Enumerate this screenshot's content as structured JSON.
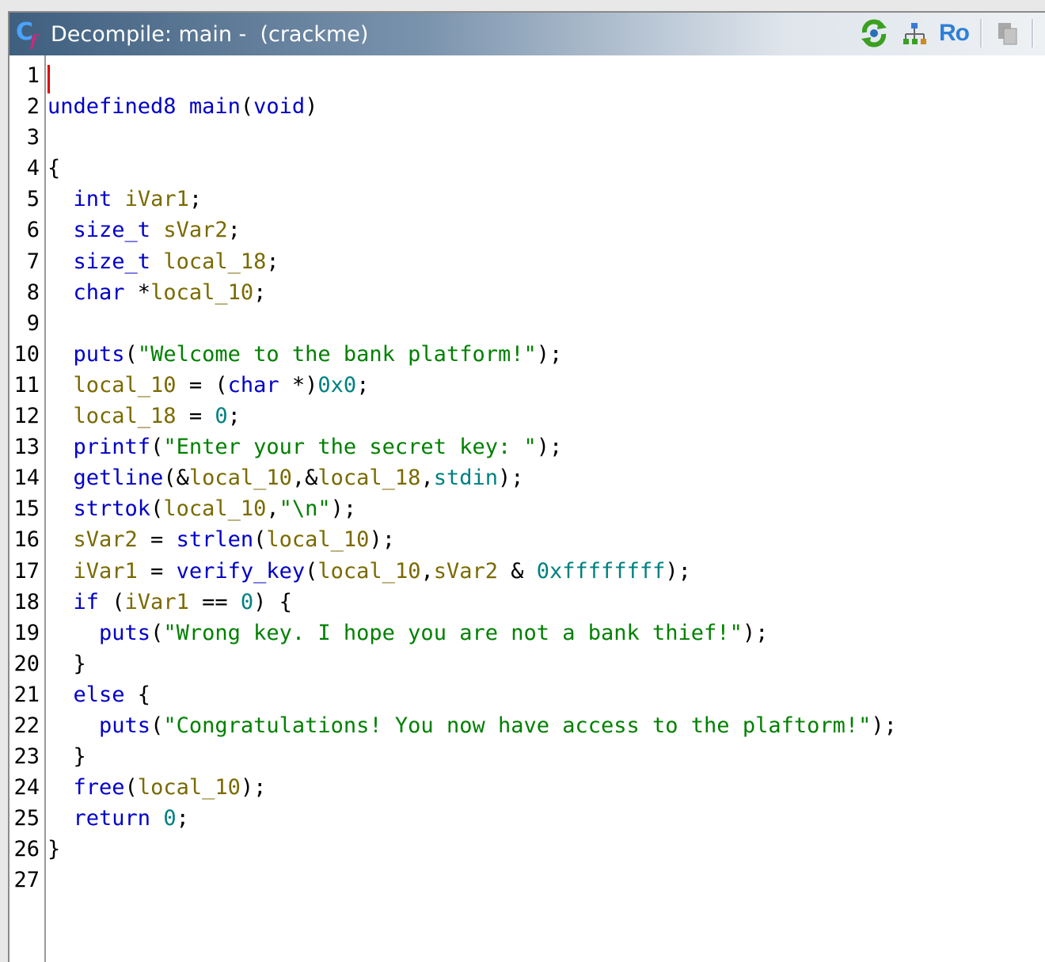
{
  "window": {
    "title": "Decompile: main -  (crackme)",
    "toolbar": {
      "ro_label": "Ro"
    }
  },
  "code": {
    "lines": [
      {
        "n": "1",
        "tokens": []
      },
      {
        "n": "2",
        "tokens": [
          [
            "undefined8",
            "ty"
          ],
          [
            " ",
            "pu"
          ],
          [
            "main",
            "fn"
          ],
          [
            "(",
            "pu"
          ],
          [
            "void",
            "ty"
          ],
          [
            ")",
            "pu"
          ]
        ]
      },
      {
        "n": "3",
        "tokens": []
      },
      {
        "n": "4",
        "tokens": [
          [
            "{",
            "pu"
          ]
        ]
      },
      {
        "n": "5",
        "tokens": [
          [
            "  ",
            "pu"
          ],
          [
            "int",
            "ty"
          ],
          [
            " ",
            "pu"
          ],
          [
            "iVar1",
            "vr"
          ],
          [
            ";",
            "pu"
          ]
        ]
      },
      {
        "n": "6",
        "tokens": [
          [
            "  ",
            "pu"
          ],
          [
            "size_t",
            "ty"
          ],
          [
            " ",
            "pu"
          ],
          [
            "sVar2",
            "vr"
          ],
          [
            ";",
            "pu"
          ]
        ]
      },
      {
        "n": "7",
        "tokens": [
          [
            "  ",
            "pu"
          ],
          [
            "size_t",
            "ty"
          ],
          [
            " ",
            "pu"
          ],
          [
            "local_18",
            "vr"
          ],
          [
            ";",
            "pu"
          ]
        ]
      },
      {
        "n": "8",
        "tokens": [
          [
            "  ",
            "pu"
          ],
          [
            "char",
            "ty"
          ],
          [
            " *",
            "pu"
          ],
          [
            "local_10",
            "vr"
          ],
          [
            ";",
            "pu"
          ]
        ]
      },
      {
        "n": "9",
        "tokens": []
      },
      {
        "n": "10",
        "tokens": [
          [
            "  ",
            "pu"
          ],
          [
            "puts",
            "fn"
          ],
          [
            "(",
            "pu"
          ],
          [
            "\"Welcome to the bank platform!\"",
            "st"
          ],
          [
            ");",
            "pu"
          ]
        ]
      },
      {
        "n": "11",
        "tokens": [
          [
            "  ",
            "pu"
          ],
          [
            "local_10",
            "vr"
          ],
          [
            " = (",
            "pu"
          ],
          [
            "char",
            "ty"
          ],
          [
            " *)",
            "pu"
          ],
          [
            "0x0",
            "nm"
          ],
          [
            ";",
            "pu"
          ]
        ]
      },
      {
        "n": "12",
        "tokens": [
          [
            "  ",
            "pu"
          ],
          [
            "local_18",
            "vr"
          ],
          [
            " = ",
            "pu"
          ],
          [
            "0",
            "nm"
          ],
          [
            ";",
            "pu"
          ]
        ]
      },
      {
        "n": "13",
        "tokens": [
          [
            "  ",
            "pu"
          ],
          [
            "printf",
            "fn"
          ],
          [
            "(",
            "pu"
          ],
          [
            "\"Enter your the secret key: \"",
            "st"
          ],
          [
            ");",
            "pu"
          ]
        ]
      },
      {
        "n": "14",
        "tokens": [
          [
            "  ",
            "pu"
          ],
          [
            "getline",
            "fn"
          ],
          [
            "(&",
            "pu"
          ],
          [
            "local_10",
            "vr"
          ],
          [
            ",&",
            "pu"
          ],
          [
            "local_18",
            "vr"
          ],
          [
            ",",
            "pu"
          ],
          [
            "stdin",
            "gv"
          ],
          [
            ");",
            "pu"
          ]
        ]
      },
      {
        "n": "15",
        "tokens": [
          [
            "  ",
            "pu"
          ],
          [
            "strtok",
            "fn"
          ],
          [
            "(",
            "pu"
          ],
          [
            "local_10",
            "vr"
          ],
          [
            ",",
            "pu"
          ],
          [
            "\"\\n\"",
            "st"
          ],
          [
            ");",
            "pu"
          ]
        ]
      },
      {
        "n": "16",
        "tokens": [
          [
            "  ",
            "pu"
          ],
          [
            "sVar2",
            "vr"
          ],
          [
            " = ",
            "pu"
          ],
          [
            "strlen",
            "fn"
          ],
          [
            "(",
            "pu"
          ],
          [
            "local_10",
            "vr"
          ],
          [
            ");",
            "pu"
          ]
        ]
      },
      {
        "n": "17",
        "tokens": [
          [
            "  ",
            "pu"
          ],
          [
            "iVar1",
            "vr"
          ],
          [
            " = ",
            "pu"
          ],
          [
            "verify_key",
            "fn"
          ],
          [
            "(",
            "pu"
          ],
          [
            "local_10",
            "vr"
          ],
          [
            ",",
            "pu"
          ],
          [
            "sVar2",
            "vr"
          ],
          [
            " & ",
            "pu"
          ],
          [
            "0xffffffff",
            "nm"
          ],
          [
            ");",
            "pu"
          ]
        ]
      },
      {
        "n": "18",
        "tokens": [
          [
            "  ",
            "pu"
          ],
          [
            "if",
            "kw"
          ],
          [
            " (",
            "pu"
          ],
          [
            "iVar1",
            "vr"
          ],
          [
            " == ",
            "pu"
          ],
          [
            "0",
            "nm"
          ],
          [
            ") {",
            "pu"
          ]
        ]
      },
      {
        "n": "19",
        "tokens": [
          [
            "    ",
            "pu"
          ],
          [
            "puts",
            "fn"
          ],
          [
            "(",
            "pu"
          ],
          [
            "\"Wrong key. I hope you are not a bank thief!\"",
            "st"
          ],
          [
            ");",
            "pu"
          ]
        ]
      },
      {
        "n": "20",
        "tokens": [
          [
            "  }",
            "pu"
          ]
        ]
      },
      {
        "n": "21",
        "tokens": [
          [
            "  ",
            "pu"
          ],
          [
            "else",
            "kw"
          ],
          [
            " {",
            "pu"
          ]
        ]
      },
      {
        "n": "22",
        "tokens": [
          [
            "    ",
            "pu"
          ],
          [
            "puts",
            "fn"
          ],
          [
            "(",
            "pu"
          ],
          [
            "\"Congratulations! You now have access to the plaftorm!\"",
            "st"
          ],
          [
            ");",
            "pu"
          ]
        ]
      },
      {
        "n": "23",
        "tokens": [
          [
            "  }",
            "pu"
          ]
        ]
      },
      {
        "n": "24",
        "tokens": [
          [
            "  ",
            "pu"
          ],
          [
            "free",
            "fn"
          ],
          [
            "(",
            "pu"
          ],
          [
            "local_10",
            "vr"
          ],
          [
            ");",
            "pu"
          ]
        ]
      },
      {
        "n": "25",
        "tokens": [
          [
            "  ",
            "pu"
          ],
          [
            "return",
            "kw"
          ],
          [
            " ",
            "pu"
          ],
          [
            "0",
            "nm"
          ],
          [
            ";",
            "pu"
          ]
        ]
      },
      {
        "n": "26",
        "tokens": [
          [
            "}",
            "pu"
          ]
        ]
      },
      {
        "n": "27",
        "tokens": []
      }
    ]
  }
}
